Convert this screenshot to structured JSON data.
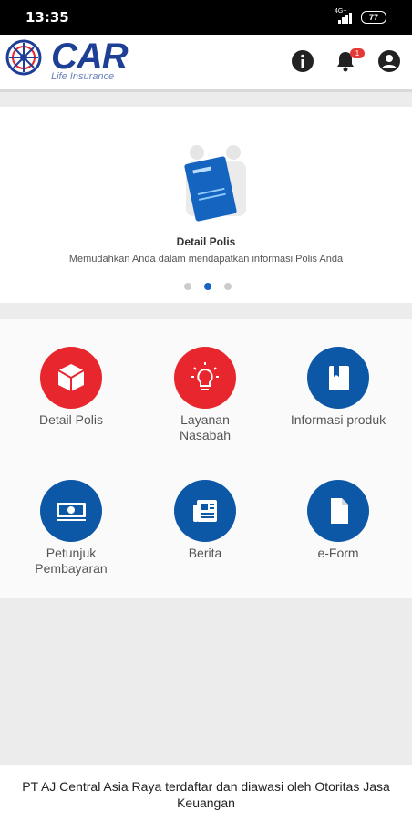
{
  "status_bar": {
    "time": "13:35",
    "network": "4G+",
    "battery": "77"
  },
  "app_bar": {
    "logo_text": "CAR",
    "logo_subtitle": "Life Insurance",
    "notification_count": "1"
  },
  "carousel": {
    "title": "Detail Polis",
    "subtitle": "Memudahkan Anda dalam mendapatkan informasi Polis Anda",
    "active_index": 1,
    "dot_count": 3
  },
  "menu": [
    {
      "label": "Detail Polis",
      "icon": "cube-icon",
      "color": "#e8262d"
    },
    {
      "label": "Layanan Nasabah",
      "icon": "lightbulb-icon",
      "color": "#e8262d"
    },
    {
      "label": "Informasi produk",
      "icon": "book-icon",
      "color": "#0d57a7"
    },
    {
      "label": "Petunjuk Pembayaran",
      "icon": "money-icon",
      "color": "#0d57a7"
    },
    {
      "label": "Berita",
      "icon": "newspaper-icon",
      "color": "#0d57a7"
    },
    {
      "label": "e-Form",
      "icon": "document-icon",
      "color": "#0d57a7"
    }
  ],
  "footer": {
    "text": "PT AJ Central Asia Raya terdaftar dan diawasi oleh Otoritas Jasa Keuangan"
  },
  "colors": {
    "brand_blue": "#1e3f96",
    "accent_red": "#e8262d",
    "accent_blue": "#0d57a7"
  }
}
